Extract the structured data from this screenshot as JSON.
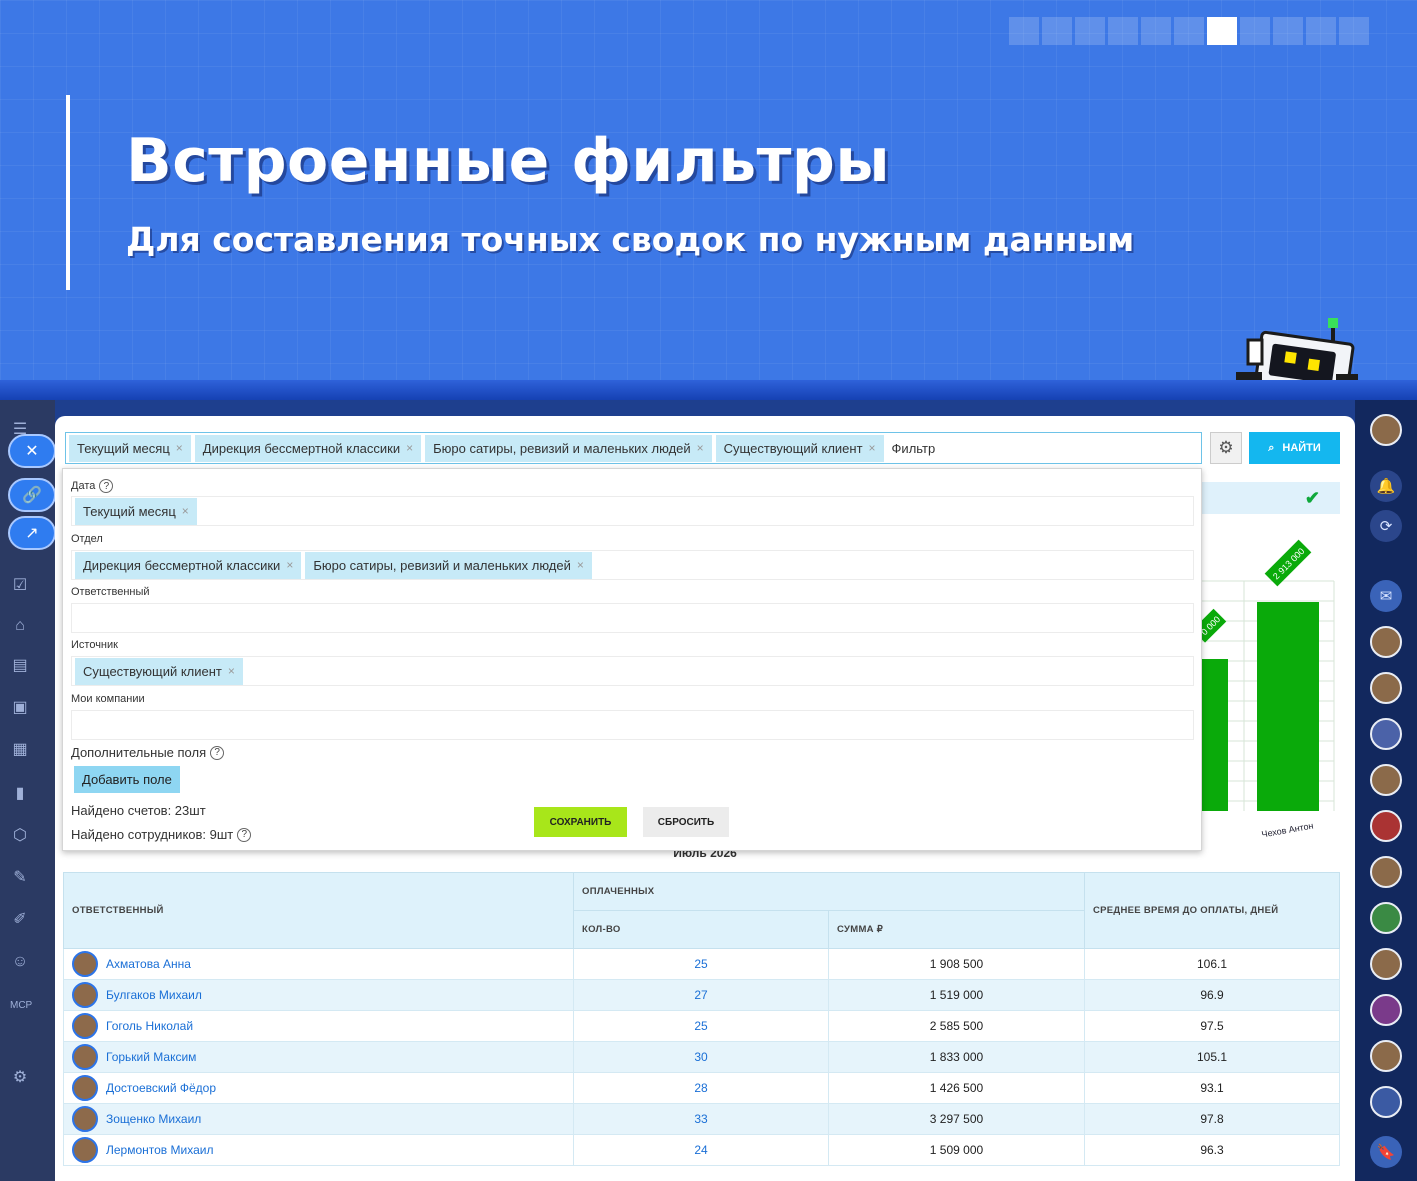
{
  "hero": {
    "title": "Встроенные фильтры",
    "subtitle": "Для составления точных сводок по нужным данным",
    "pager_count": 11,
    "pager_active": 7
  },
  "search": {
    "chips": [
      "Текущий месяц",
      "Дирекция бессмертной классики",
      "Бюро сатиры, ревизий и маленьких людей",
      "Существующий клиент"
    ],
    "placeholder": "Фильтр",
    "find_label": "НАЙТИ"
  },
  "filter": {
    "date_label": "Дата",
    "date_chips": [
      "Текущий месяц"
    ],
    "dept_label": "Отдел",
    "dept_chips": [
      "Дирекция бессмертной классики",
      "Бюро сатиры, ревизий и маленьких людей"
    ],
    "responsible_label": "Ответственный",
    "source_label": "Источник",
    "source_chips": [
      "Существующий клиент"
    ],
    "companies_label": "Мои компании",
    "extra_label": "Дополнительные поля",
    "add_field": "Добавить поле",
    "found_accounts": "Найдено счетов: 23шт",
    "found_employees": "Найдено сотрудников: 9шт",
    "save": "СОХРАНИТЬ",
    "reset": "СБРОСИТЬ"
  },
  "chart_data": {
    "type": "bar",
    "visible_labels": [
      "2 913 000",
      "0 000"
    ],
    "visible_category": "Чехов Антон",
    "values": [
      2913000
    ]
  },
  "month": "Июль 2026",
  "table": {
    "col_responsible": "ОТВЕТСТВЕННЫЙ",
    "col_paid": "ОПЛАЧЕННЫХ",
    "col_count": "КОЛ-ВО",
    "col_sum": "СУММА ₽",
    "col_avg": "СРЕДНЕЕ ВРЕМЯ ДО ОПЛАТЫ, ДНЕЙ",
    "rows": [
      {
        "name": "Ахматова Анна",
        "count": "25",
        "sum": "1 908 500",
        "avg": "106.1"
      },
      {
        "name": "Булгаков Михаил",
        "count": "27",
        "sum": "1 519 000",
        "avg": "96.9"
      },
      {
        "name": "Гоголь Николай",
        "count": "25",
        "sum": "2 585 500",
        "avg": "97.5"
      },
      {
        "name": "Горький Максим",
        "count": "30",
        "sum": "1 833 000",
        "avg": "105.1"
      },
      {
        "name": "Достоевский Фёдор",
        "count": "28",
        "sum": "1 426 500",
        "avg": "93.1"
      },
      {
        "name": "Зощенко Михаил",
        "count": "33",
        "sum": "3 297 500",
        "avg": "97.8"
      },
      {
        "name": "Лермонтов Михаил",
        "count": "24",
        "sum": "1 509 000",
        "avg": "96.3"
      }
    ]
  },
  "colors": {
    "accent": "#14b7ef",
    "save": "#a8e61a",
    "chart_bar": "#0aaa0a"
  }
}
